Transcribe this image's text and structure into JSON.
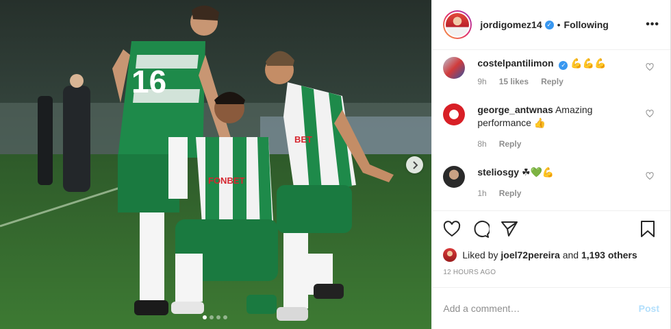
{
  "post": {
    "username": "jordigomez14",
    "separator": "•",
    "follow_status": "Following",
    "more_icon": "more-horizontal-icon"
  },
  "comments": [
    {
      "username": "costelpantilimon",
      "verified": true,
      "text": "💪💪💪",
      "time": "9h",
      "likes": "15 likes",
      "reply": "Reply"
    },
    {
      "username": "george_antwnas",
      "verified": false,
      "text": "Amazing performance 👍",
      "time": "8h",
      "reply": "Reply"
    },
    {
      "username": "steliosgy",
      "verified": false,
      "text": "☘💚💪",
      "time": "1h",
      "reply": "Reply"
    }
  ],
  "likes": {
    "prefix": "Liked by",
    "user": "joel72pereira",
    "middle": "and",
    "others": "1,193 others"
  },
  "timestamp": "12 HOURS AGO",
  "comment_box": {
    "placeholder": "Add a comment…",
    "post_label": "Post"
  },
  "carousel": {
    "current": 1,
    "total": 4
  },
  "colors": {
    "accent": "#3897f0",
    "post_disabled": "#b2dffc",
    "jersey_green": "#1e8a4a"
  }
}
